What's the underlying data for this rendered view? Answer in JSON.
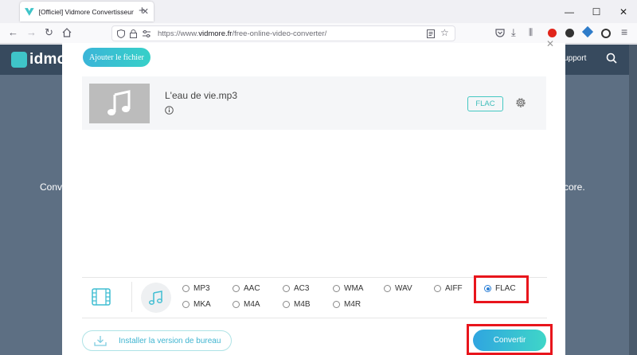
{
  "browser": {
    "tab_title": "[Officiel] Vidmore Convertisseur",
    "url_prefix": "https://www.",
    "url_domain": "vidmore.fr",
    "url_path": "/free-online-video-converter/"
  },
  "site": {
    "logo_text": "idmo",
    "support_label": "upport",
    "bg_text_left": "Conv",
    "bg_text_right": "core."
  },
  "converter": {
    "add_file_label": "Ajouter le fichier",
    "file": {
      "name": "L'eau de vie.mp3",
      "format_badge": "FLAC"
    },
    "formats_row1": [
      "MP3",
      "AAC",
      "AC3",
      "WMA",
      "WAV",
      "AIFF",
      "FLAC"
    ],
    "formats_row2": [
      "MKA",
      "M4A",
      "M4B",
      "M4R"
    ],
    "selected_format": "FLAC",
    "install_label": "Installer la version de bureau",
    "convert_label": "Convertir"
  },
  "colors": {
    "accent": "#3fc4c8",
    "highlight": "#e8151c",
    "radio_selected": "#2a7fd6"
  }
}
